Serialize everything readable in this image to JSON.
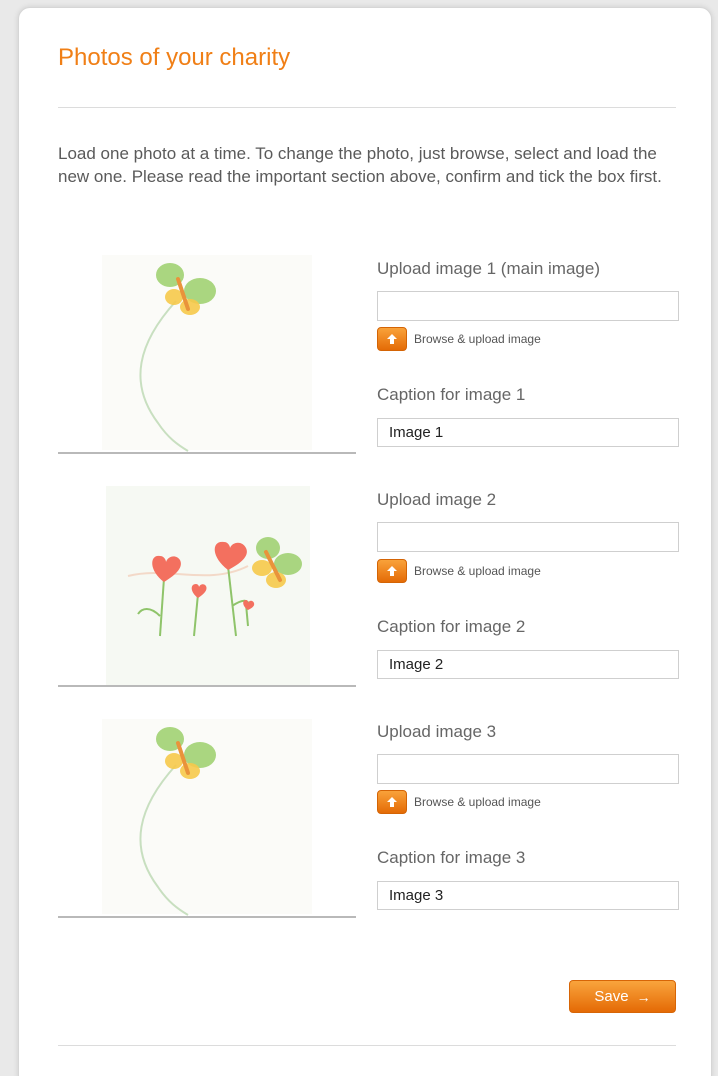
{
  "page": {
    "title": "Photos of your charity",
    "intro": "Load one photo at a time. To change the photo, just browse, select and load the new one. Please read the important section above, confirm and tick the box first."
  },
  "uploads": [
    {
      "upload_label": "Upload image 1 (main image)",
      "browse_label": "Browse & upload image",
      "caption_label": "Caption for image 1",
      "caption_value": "Image 1",
      "thumbnail": "butterfly-placeholder"
    },
    {
      "upload_label": "Upload image 2",
      "browse_label": "Browse & upload image",
      "caption_label": "Caption for image 2",
      "caption_value": "Image 2",
      "thumbnail": "hearts-flowers-placeholder"
    },
    {
      "upload_label": "Upload image 3",
      "browse_label": "Browse & upload image",
      "caption_label": "Caption for image 3",
      "caption_value": "Image 3",
      "thumbnail": "butterfly-placeholder"
    }
  ],
  "actions": {
    "save_label": "Save",
    "save_icon": "arrow-right-icon"
  },
  "colors": {
    "accent": "#f07f16",
    "button_top": "#f9a43d",
    "button_bottom": "#e46a05"
  }
}
